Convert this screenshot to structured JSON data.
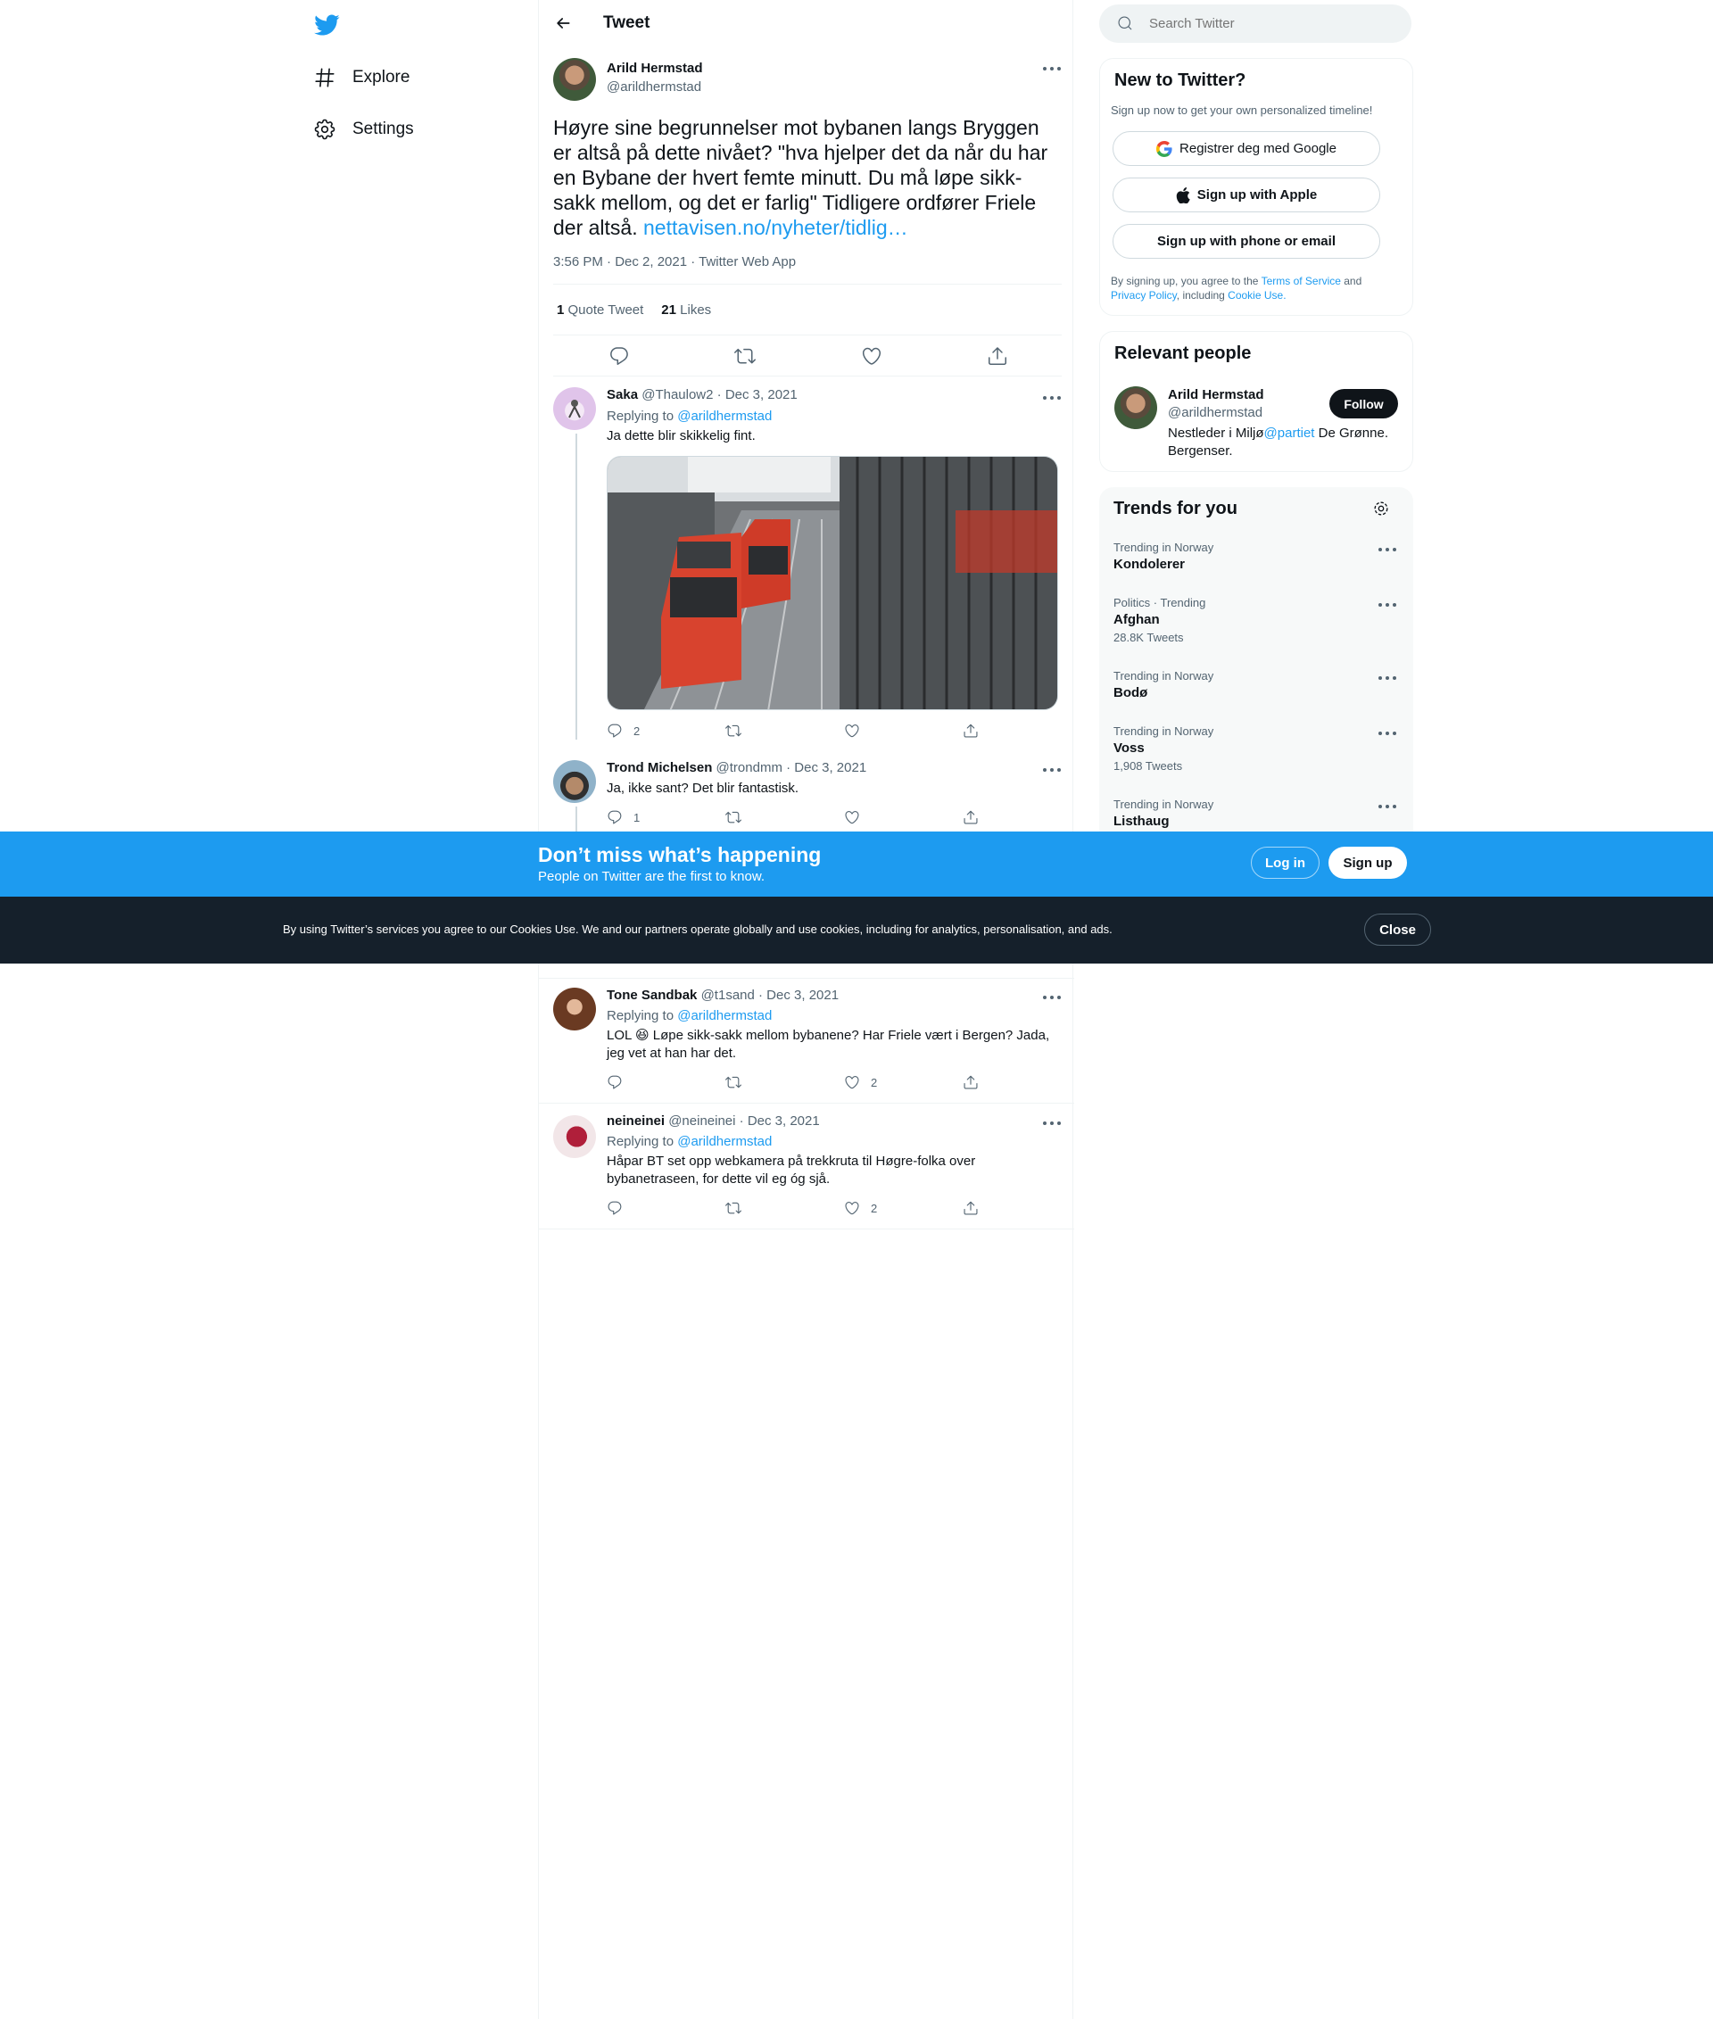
{
  "nav": {
    "items": [
      {
        "label": "Explore",
        "icon": "hashtag-icon"
      },
      {
        "label": "Settings",
        "icon": "gear-icon"
      }
    ]
  },
  "header": {
    "title": "Tweet"
  },
  "tweet": {
    "author_name": "Arild Hermstad",
    "author_handle": "@arildhermstad",
    "text": "Høyre sine begrunnelser mot bybanen langs Bryggen er altså på dette nivået? \"hva hjelper det da når du har en Bybane der hvert femte minutt. Du må løpe sikk-sakk mellom, og det er farlig\" Tidligere ordfører Friele der altså. ",
    "link": "nettavisen.no/nyheter/tidlig…",
    "meta": "3:56 PM · Dec 2, 2021 · Twitter Web App",
    "quote_count": "1",
    "quote_label": "Quote Tweet",
    "likes_count": "21",
    "likes_label": "Likes"
  },
  "replies": [
    {
      "name": "Saka",
      "handle": "@Thaulow2",
      "date": "· Dec 3, 2021",
      "replying_label": "Replying to",
      "replying_to": "@arildhermstad",
      "text": "Ja dette blir skikkelig fint.",
      "reply_count": "2",
      "like_count": ""
    },
    {
      "name": "Trond Michelsen",
      "handle": "@trondmm",
      "date": "· Dec 3, 2021",
      "text": "Ja, ikke sant? Det blir fantastisk.",
      "reply_count": "1",
      "like_count": ""
    },
    {
      "name": "Tone Sandbak",
      "handle": "@t1sand",
      "date": "· Dec 3, 2021",
      "replying_label": "Replying to",
      "replying_to": "@arildhermstad",
      "text_1": "LOL 😆 Løpe sikk-sakk mellom bybanene? Har Friele vært i Bergen? Jada,",
      "text_2": "jeg vet at han har det.",
      "reply_count": "",
      "like_count": "2"
    },
    {
      "name": "neineinei",
      "handle": "@neineinei",
      "date": "· Dec 3, 2021",
      "replying_label": "Replying to",
      "replying_to": "@arildhermstad",
      "text_1": "Håpar BT set opp webkamera på trekkruta til Høgre-folka over",
      "text_2": "bybanetraseen, for dette vil eg óg sjå.",
      "reply_count": "",
      "like_count": "2"
    }
  ],
  "search": {
    "placeholder": "Search Twitter"
  },
  "new_to_twitter": {
    "title": "New to Twitter?",
    "subtitle": "Sign up now to get your own personalized timeline!",
    "google_label": "Registrer deg med Google",
    "apple_label": "Sign up with Apple",
    "phone_label": "Sign up with phone or email",
    "legal_1": "By signing up, you agree to the ",
    "tos": "Terms of Service",
    "and": " and",
    "privacy": "Privacy Policy",
    "including": ", including ",
    "cookie": "Cookie Use."
  },
  "relevant_people": {
    "title": "Relevant people",
    "name": "Arild Hermstad",
    "handle": "@arildhermstad",
    "follow_label": "Follow",
    "bio_1": "Nestleder i Miljø",
    "bio_mention": "@partiet",
    "bio_2": " De Grønne.",
    "bio_3": "Bergenser."
  },
  "trends": {
    "title": "Trends for you",
    "items": [
      {
        "meta": "Trending in Norway",
        "name": "Kondolerer",
        "count": ""
      },
      {
        "meta": "Politics · Trending",
        "name": "Afghan",
        "count": "28.8K Tweets"
      },
      {
        "meta": "Trending in Norway",
        "name": "Bodø",
        "count": ""
      },
      {
        "meta": "Trending in Norway",
        "name": "Voss",
        "count": "1,908 Tweets"
      },
      {
        "meta": "Trending in Norway",
        "name": "Listhaug",
        "count": ""
      }
    ]
  },
  "signup_bar": {
    "title": "Don’t miss what’s happening",
    "subtitle": "People on Twitter are the first to know.",
    "login_label": "Log in",
    "signup_label": "Sign up"
  },
  "cookie_bar": {
    "text": "By using Twitter’s services you agree to our Cookies Use. We and our partners operate globally and use cookies, including for analytics, personalisation, and ads.",
    "close_label": "Close"
  },
  "colors": {
    "accent": "#1d9bf0",
    "text": "#0f1419",
    "muted": "#536471",
    "dark_bar": "#15202b"
  }
}
